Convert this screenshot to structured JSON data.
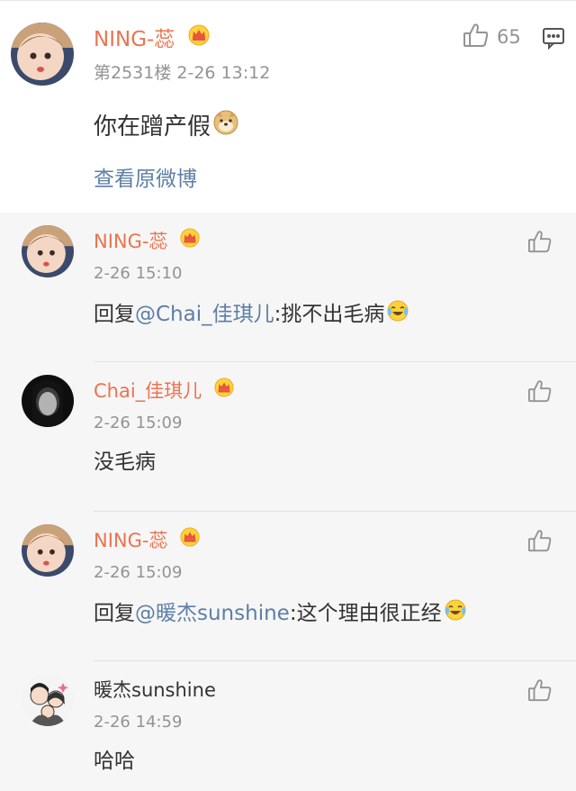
{
  "main_comment": {
    "username": "NING-蕊",
    "floor_time": "第2531楼 2-26 13:12",
    "like_count": "65",
    "text": "你在蹭产假",
    "view_original": "查看原微博"
  },
  "replies": [
    {
      "username": "NING-蕊",
      "time": "2-26 15:10",
      "prefix": "回复",
      "mention": "@Chai_佳琪儿",
      "content": ":挑不出毛病"
    },
    {
      "username": "Chai_佳琪儿",
      "time": "2-26 15:09",
      "content": "没毛病"
    },
    {
      "username": "NING-蕊",
      "time": "2-26 15:09",
      "prefix": "回复",
      "mention": "@暖杰sunshine",
      "content": ":这个理由很正经"
    },
    {
      "username": "暖杰sunshine",
      "time": "2-26 14:59",
      "content": "哈哈"
    }
  ],
  "colors": {
    "username": "#eb7350",
    "link": "#5d7fa5",
    "meta": "#939393",
    "reply_bg": "#f6f6f6"
  },
  "icons": [
    "crown-vip-icon",
    "thumbs-up-icon",
    "comment-icon",
    "doge-emoji",
    "laugh-cry-emoji"
  ]
}
